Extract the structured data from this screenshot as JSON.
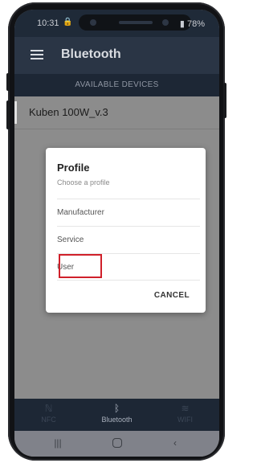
{
  "status_bar": {
    "time": "10:31",
    "lock_glyph": "🔒",
    "signal_battery": "78%"
  },
  "app_bar": {
    "menu_icon": "hamburger-menu",
    "title": "Bluetooth"
  },
  "section_header": "AVAILABLE DEVICES",
  "devices": [
    {
      "name": "Kuben 100W_v.3"
    }
  ],
  "dialog": {
    "title": "Profile",
    "subtitle": "Choose a profile",
    "options": [
      "Manufacturer",
      "Service",
      "User"
    ],
    "highlighted_option": "User",
    "highlight_color": "#d0202a",
    "cancel_label": "CANCEL"
  },
  "bottom_nav": [
    {
      "icon": "nfc-icon",
      "label": "NFC",
      "active": false
    },
    {
      "icon": "bluetooth-icon",
      "label": "Bluetooth",
      "active": true
    },
    {
      "icon": "wifi-icon",
      "label": "WIFI",
      "active": false
    }
  ],
  "system_nav": [
    "recent-apps-icon",
    "home-icon",
    "back-icon"
  ],
  "colors": {
    "app_bar": "#2a3545",
    "status_bar": "#1f2a38",
    "dialog_bg": "#ffffff"
  }
}
